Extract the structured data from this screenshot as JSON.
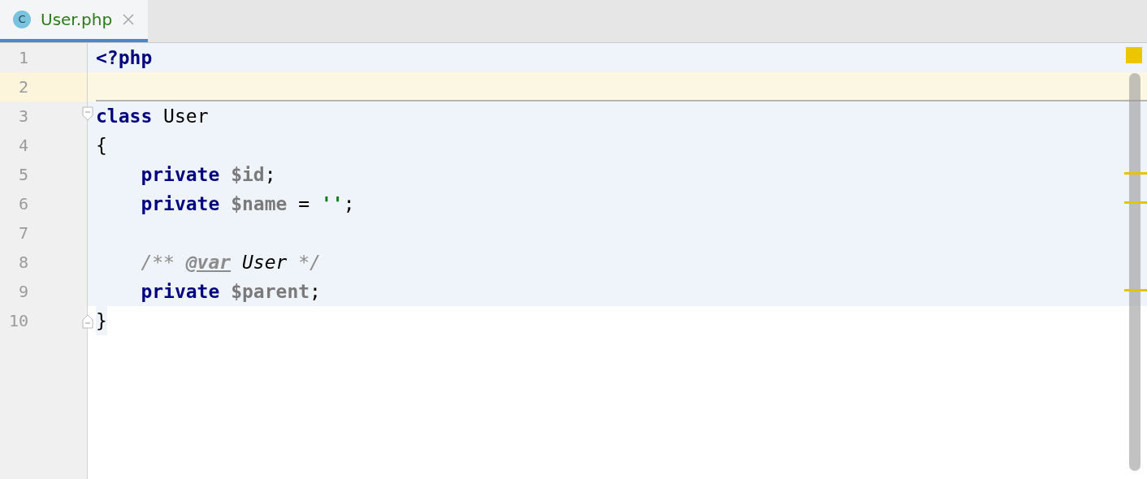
{
  "tabs": [
    {
      "icon_letter": "C",
      "label": "User.php",
      "selected": true
    }
  ],
  "status_indicator": {
    "color": "#ecc700"
  },
  "lines": [
    {
      "number": "1",
      "highlighted": true,
      "whole_row": true,
      "tokens": [
        {
          "kind": "keyword",
          "text": "<?php"
        }
      ]
    },
    {
      "number": "2",
      "current": true,
      "separator_below": true
    },
    {
      "number": "3",
      "highlighted": true,
      "whole_row": true,
      "fold_start": true,
      "tokens": [
        {
          "kind": "keyword",
          "text": "class"
        },
        {
          "kind": "plain",
          "text": " User"
        }
      ]
    },
    {
      "number": "4",
      "highlighted": true,
      "whole_row": true,
      "tokens": [
        {
          "kind": "plain",
          "text": "{"
        }
      ]
    },
    {
      "number": "5",
      "highlighted": true,
      "whole_row": true,
      "indented": true,
      "warning": true,
      "tokens": [
        {
          "kind": "keyword",
          "text": "private"
        },
        {
          "kind": "variable",
          "text": " $id"
        },
        {
          "kind": "plain",
          "text": ";"
        }
      ]
    },
    {
      "number": "6",
      "highlighted": true,
      "whole_row": true,
      "indented": true,
      "warning": true,
      "tokens": [
        {
          "kind": "keyword",
          "text": "private"
        },
        {
          "kind": "variable",
          "text": " $name"
        },
        {
          "kind": "plain",
          "text": " ="
        },
        {
          "kind": "string",
          "text": " ''"
        },
        {
          "kind": "plain",
          "text": ";"
        }
      ]
    },
    {
      "number": "7",
      "highlighted": true,
      "whole_row": true
    },
    {
      "number": "8",
      "highlighted": true,
      "whole_row": true,
      "indented": true,
      "tokens": [
        {
          "kind": "comment",
          "text": "/** "
        },
        {
          "kind": "doctag",
          "text": "@var"
        },
        {
          "kind": "doctype",
          "text": " User"
        },
        {
          "kind": "comment",
          "text": " */"
        }
      ]
    },
    {
      "number": "9",
      "highlighted": true,
      "whole_row": true,
      "indented": true,
      "warning": true,
      "tokens": [
        {
          "kind": "keyword",
          "text": "private"
        },
        {
          "kind": "variable",
          "text": " $parent"
        },
        {
          "kind": "plain",
          "text": ";"
        }
      ]
    },
    {
      "number": "10",
      "highlighted": true,
      "whole_row": false,
      "fold_end": true,
      "tokens": [
        {
          "kind": "plain",
          "text": "}"
        }
      ]
    }
  ]
}
